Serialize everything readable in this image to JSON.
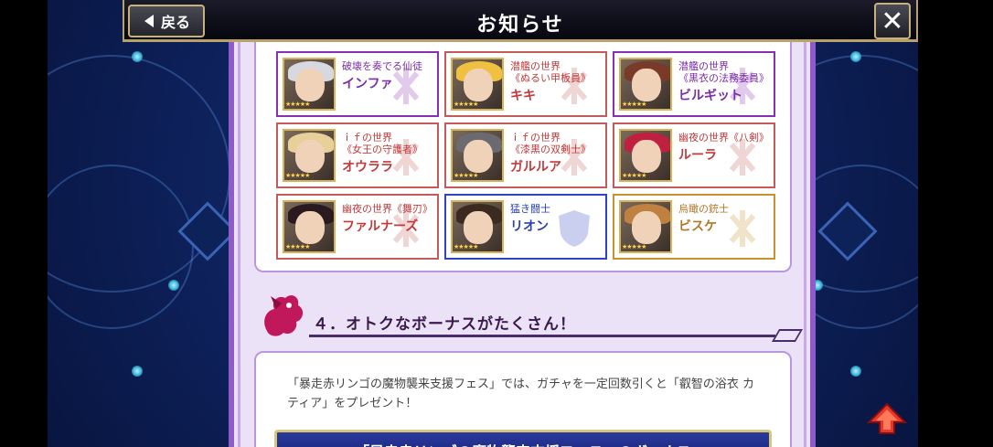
{
  "header": {
    "title": "お知らせ",
    "back_label": "戻る",
    "close_label": "✕"
  },
  "units": [
    {
      "subtitle": "破壊を奏でる仙徒",
      "name": "インファ",
      "frame": "purple",
      "stars": "★★★★★"
    },
    {
      "subtitle": "潜艦の世界\n《ぬるい甲板員》",
      "name": "キキ",
      "frame": "red",
      "stars": "★★★★★"
    },
    {
      "subtitle": "潜艦の世界\n《黒衣の法務委員》",
      "name": "ビルギット",
      "frame": "purple",
      "stars": "★★★★★"
    },
    {
      "subtitle": "ｉｆの世界\n《女王の守護者》",
      "name": "オウララ",
      "frame": "red",
      "stars": "★★★★★"
    },
    {
      "subtitle": "ｉｆの世界\n《漆黒の双剣士》",
      "name": "ガルルア",
      "frame": "red",
      "stars": "★★★★★"
    },
    {
      "subtitle": "幽夜の世界《八剣》",
      "name": "ルーラ",
      "frame": "red",
      "stars": "★★★★★"
    },
    {
      "subtitle": "幽夜の世界《舞刃》",
      "name": "ファルナーズ",
      "frame": "red",
      "stars": "★★★★★"
    },
    {
      "subtitle": "猛き闘士",
      "name": "リオン",
      "frame": "blue",
      "stars": "★★★★★"
    },
    {
      "subtitle": "烏瞰の銃士",
      "name": "ビスケ",
      "frame": "gold",
      "stars": "★★★★★"
    }
  ],
  "section": {
    "title": "４．オトクなボーナスがたくさん！"
  },
  "body": {
    "paragraph": "「暴走赤リンゴの魔物襲来支援フェス」では、ガチャを一定回数引くと「叡智の浴衣 カティア」をプレゼント！",
    "banner": "「暴走赤リンゴの魔物襲来支援フェス」のボーナス"
  },
  "colors": {
    "frame_red": "#c45b5b",
    "frame_purple": "#8a2fb2",
    "frame_blue": "#2f44c4",
    "frame_gold": "#c9922f",
    "panel_bg": "#ebe2f7",
    "accent_gold": "#c9b27a"
  },
  "icons": {
    "back": "chevron-left-icon",
    "close": "close-icon",
    "section": "dragon-icon",
    "scroll": "arrow-up-icon"
  }
}
